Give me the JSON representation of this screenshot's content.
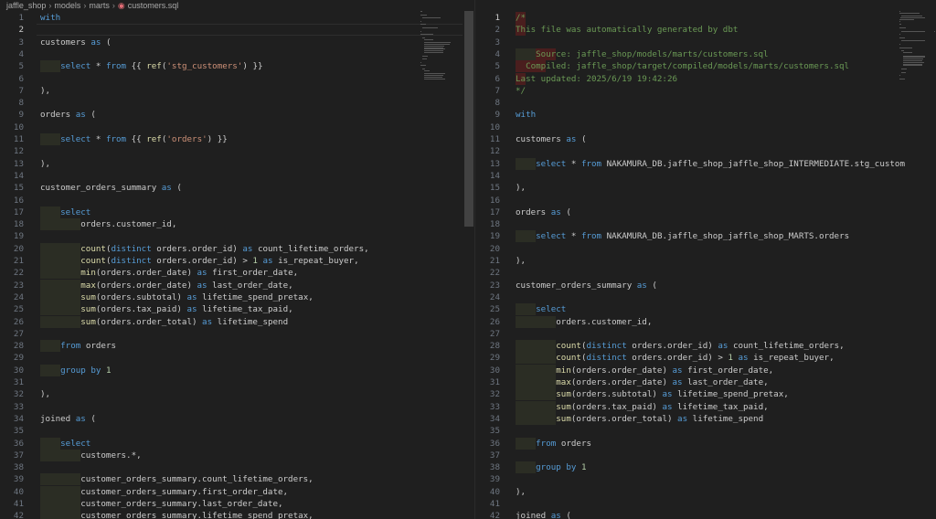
{
  "breadcrumb": {
    "items": [
      "jaffle_shop",
      "models",
      "marts"
    ],
    "file": "customers.sql"
  },
  "left": {
    "active_line": 2,
    "lines": [
      [
        [
          "with",
          "kw"
        ]
      ],
      [],
      [
        [
          "customers ",
          ""
        ],
        [
          "as",
          "kw"
        ],
        [
          " (",
          ""
        ]
      ],
      [],
      [
        [
          "    ",
          ""
        ],
        [
          "select",
          "kw"
        ],
        [
          " * ",
          ""
        ],
        [
          "from",
          "kw"
        ],
        [
          " {{ ",
          ""
        ],
        [
          "ref",
          "fn"
        ],
        [
          "(",
          ""
        ],
        [
          "'stg_customers'",
          "str"
        ],
        [
          ") }}",
          ""
        ]
      ],
      [],
      [
        [
          "),",
          ""
        ]
      ],
      [],
      [
        [
          "orders ",
          ""
        ],
        [
          "as",
          "kw"
        ],
        [
          " (",
          ""
        ]
      ],
      [],
      [
        [
          "    ",
          ""
        ],
        [
          "select",
          "kw"
        ],
        [
          " * ",
          ""
        ],
        [
          "from",
          "kw"
        ],
        [
          " {{ ",
          ""
        ],
        [
          "ref",
          "fn"
        ],
        [
          "(",
          ""
        ],
        [
          "'orders'",
          "str"
        ],
        [
          ") }}",
          ""
        ]
      ],
      [],
      [
        [
          "),",
          ""
        ]
      ],
      [],
      [
        [
          "customer_orders_summary ",
          ""
        ],
        [
          "as",
          "kw"
        ],
        [
          " (",
          ""
        ]
      ],
      [],
      [
        [
          "    ",
          ""
        ],
        [
          "select",
          "kw"
        ]
      ],
      [
        [
          "        orders.customer_id,",
          ""
        ]
      ],
      [],
      [
        [
          "        ",
          ""
        ],
        [
          "count",
          "fn"
        ],
        [
          "(",
          ""
        ],
        [
          "distinct",
          "kw"
        ],
        [
          " orders.order_id) ",
          ""
        ],
        [
          "as",
          "kw"
        ],
        [
          " count_lifetime_orders,",
          ""
        ]
      ],
      [
        [
          "        ",
          ""
        ],
        [
          "count",
          "fn"
        ],
        [
          "(",
          ""
        ],
        [
          "distinct",
          "kw"
        ],
        [
          " orders.order_id) > ",
          ""
        ],
        [
          "1",
          "num"
        ],
        [
          " ",
          ""
        ],
        [
          "as",
          "kw"
        ],
        [
          " is_repeat_buyer,",
          ""
        ]
      ],
      [
        [
          "        ",
          ""
        ],
        [
          "min",
          "fn"
        ],
        [
          "(orders.order_date) ",
          ""
        ],
        [
          "as",
          "kw"
        ],
        [
          " first_order_date,",
          ""
        ]
      ],
      [
        [
          "        ",
          ""
        ],
        [
          "max",
          "fn"
        ],
        [
          "(orders.order_date) ",
          ""
        ],
        [
          "as",
          "kw"
        ],
        [
          " last_order_date,",
          ""
        ]
      ],
      [
        [
          "        ",
          ""
        ],
        [
          "sum",
          "fn"
        ],
        [
          "(orders.subtotal) ",
          ""
        ],
        [
          "as",
          "kw"
        ],
        [
          " lifetime_spend_pretax,",
          ""
        ]
      ],
      [
        [
          "        ",
          ""
        ],
        [
          "sum",
          "fn"
        ],
        [
          "(orders.tax_paid) ",
          ""
        ],
        [
          "as",
          "kw"
        ],
        [
          " lifetime_tax_paid,",
          ""
        ]
      ],
      [
        [
          "        ",
          ""
        ],
        [
          "sum",
          "fn"
        ],
        [
          "(orders.order_total) ",
          ""
        ],
        [
          "as",
          "kw"
        ],
        [
          " lifetime_spend",
          ""
        ]
      ],
      [],
      [
        [
          "    ",
          ""
        ],
        [
          "from",
          "kw"
        ],
        [
          " orders",
          ""
        ]
      ],
      [],
      [
        [
          "    ",
          ""
        ],
        [
          "group by",
          "kw"
        ],
        [
          " ",
          ""
        ],
        [
          "1",
          "num"
        ]
      ],
      [],
      [
        [
          "),",
          ""
        ]
      ],
      [],
      [
        [
          "joined ",
          ""
        ],
        [
          "as",
          "kw"
        ],
        [
          " (",
          ""
        ]
      ],
      [],
      [
        [
          "    ",
          ""
        ],
        [
          "select",
          "kw"
        ]
      ],
      [
        [
          "        customers.*,",
          ""
        ]
      ],
      [],
      [
        [
          "        customer_orders_summary.count_lifetime_orders,",
          ""
        ]
      ],
      [
        [
          "        customer_orders_summary.first_order_date,",
          ""
        ]
      ],
      [
        [
          "        customer_orders_summary.last_order_date,",
          ""
        ]
      ],
      [
        [
          "        customer_orders_summary.lifetime_spend_pretax,",
          ""
        ]
      ]
    ]
  },
  "right": {
    "active_line": 1,
    "lines": [
      [
        [
          "/*",
          "cmt"
        ]
      ],
      [
        [
          "This file was automatically generated by dbt",
          "cmt"
        ]
      ],
      [],
      [
        [
          "    Source: jaffle_shop/models/marts/customers.sql",
          "cmt"
        ]
      ],
      [
        [
          "  Compiled: jaffle_shop/target/compiled/models/marts/customers.sql",
          "cmt"
        ]
      ],
      [
        [
          "Last updated: 2025/6/19 19:42:26",
          "cmt"
        ]
      ],
      [
        [
          "*/",
          "cmt"
        ]
      ],
      [],
      [
        [
          "with",
          "kw"
        ]
      ],
      [],
      [
        [
          "customers ",
          ""
        ],
        [
          "as",
          "kw"
        ],
        [
          " (",
          ""
        ]
      ],
      [],
      [
        [
          "    ",
          ""
        ],
        [
          "select",
          "kw"
        ],
        [
          " * ",
          ""
        ],
        [
          "from",
          "kw"
        ],
        [
          " NAKAMURA_DB.jaffle_shop_jaffle_shop_INTERMEDIATE.stg_custom",
          ""
        ]
      ],
      [],
      [
        [
          "),",
          ""
        ]
      ],
      [],
      [
        [
          "orders ",
          ""
        ],
        [
          "as",
          "kw"
        ],
        [
          " (",
          ""
        ]
      ],
      [],
      [
        [
          "    ",
          ""
        ],
        [
          "select",
          "kw"
        ],
        [
          " * ",
          ""
        ],
        [
          "from",
          "kw"
        ],
        [
          " NAKAMURA_DB.jaffle_shop_jaffle_shop_MARTS.orders",
          ""
        ]
      ],
      [],
      [
        [
          "),",
          ""
        ]
      ],
      [],
      [
        [
          "customer_orders_summary ",
          ""
        ],
        [
          "as",
          "kw"
        ],
        [
          " (",
          ""
        ]
      ],
      [],
      [
        [
          "    ",
          ""
        ],
        [
          "select",
          "kw"
        ]
      ],
      [
        [
          "        orders.customer_id,",
          ""
        ]
      ],
      [],
      [
        [
          "        ",
          ""
        ],
        [
          "count",
          "fn"
        ],
        [
          "(",
          ""
        ],
        [
          "distinct",
          "kw"
        ],
        [
          " orders.order_id) ",
          ""
        ],
        [
          "as",
          "kw"
        ],
        [
          " count_lifetime_orders,",
          ""
        ]
      ],
      [
        [
          "        ",
          ""
        ],
        [
          "count",
          "fn"
        ],
        [
          "(",
          ""
        ],
        [
          "distinct",
          "kw"
        ],
        [
          " orders.order_id) > ",
          ""
        ],
        [
          "1",
          "num"
        ],
        [
          " ",
          ""
        ],
        [
          "as",
          "kw"
        ],
        [
          " is_repeat_buyer,",
          ""
        ]
      ],
      [
        [
          "        ",
          ""
        ],
        [
          "min",
          "fn"
        ],
        [
          "(orders.order_date) ",
          ""
        ],
        [
          "as",
          "kw"
        ],
        [
          " first_order_date,",
          ""
        ]
      ],
      [
        [
          "        ",
          ""
        ],
        [
          "max",
          "fn"
        ],
        [
          "(orders.order_date) ",
          ""
        ],
        [
          "as",
          "kw"
        ],
        [
          " last_order_date,",
          ""
        ]
      ],
      [
        [
          "        ",
          ""
        ],
        [
          "sum",
          "fn"
        ],
        [
          "(orders.subtotal) ",
          ""
        ],
        [
          "as",
          "kw"
        ],
        [
          " lifetime_spend_pretax,",
          ""
        ]
      ],
      [
        [
          "        ",
          ""
        ],
        [
          "sum",
          "fn"
        ],
        [
          "(orders.tax_paid) ",
          ""
        ],
        [
          "as",
          "kw"
        ],
        [
          " lifetime_tax_paid,",
          ""
        ]
      ],
      [
        [
          "        ",
          ""
        ],
        [
          "sum",
          "fn"
        ],
        [
          "(orders.order_total) ",
          ""
        ],
        [
          "as",
          "kw"
        ],
        [
          " lifetime_spend",
          ""
        ]
      ],
      [],
      [
        [
          "    ",
          ""
        ],
        [
          "from",
          "kw"
        ],
        [
          " orders",
          ""
        ]
      ],
      [],
      [
        [
          "    ",
          ""
        ],
        [
          "group by",
          "kw"
        ],
        [
          " ",
          ""
        ],
        [
          "1",
          "num"
        ]
      ],
      [],
      [
        [
          "),",
          ""
        ]
      ],
      [],
      [
        [
          "joined ",
          ""
        ],
        [
          "as",
          "kw"
        ],
        [
          " (",
          ""
        ]
      ],
      []
    ]
  }
}
